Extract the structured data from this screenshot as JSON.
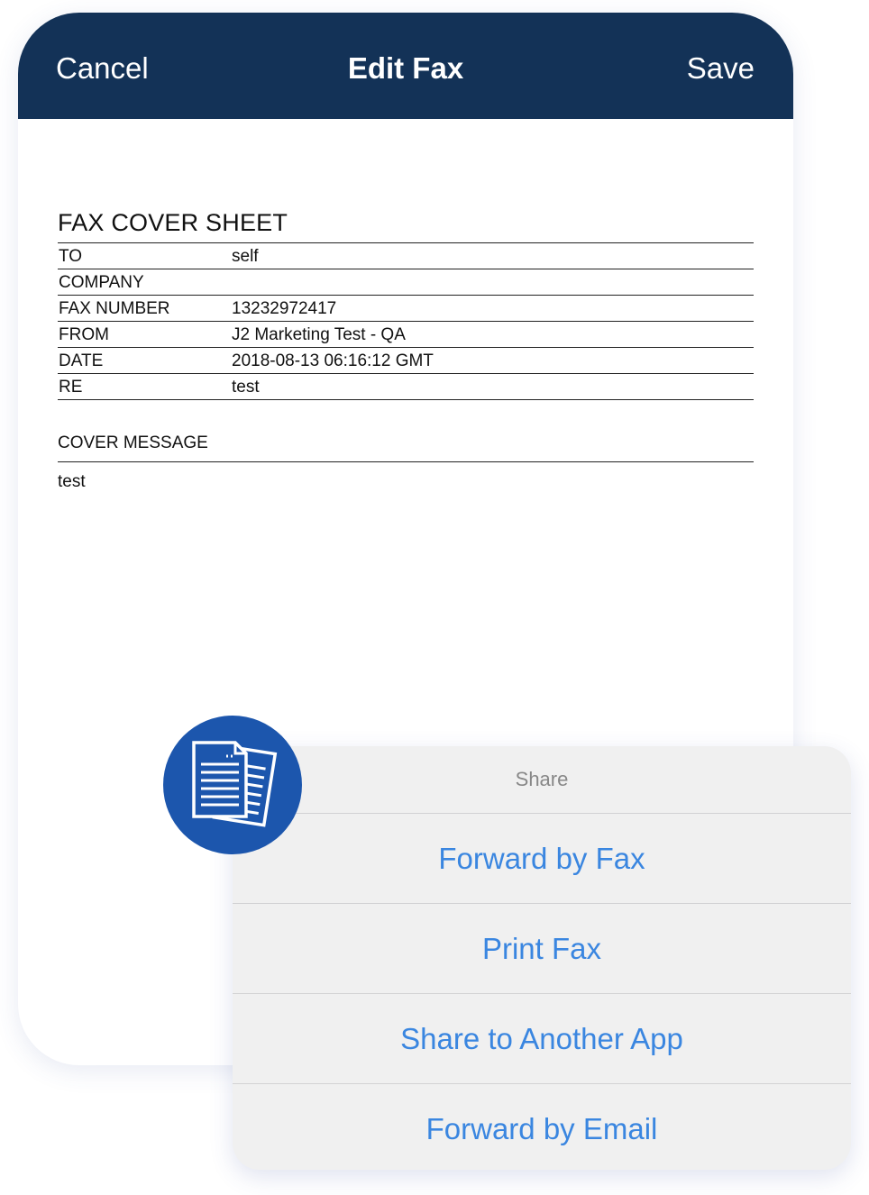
{
  "navbar": {
    "cancel_label": "Cancel",
    "title": "Edit Fax",
    "save_label": "Save",
    "background_color": "#133257"
  },
  "document": {
    "title": "FAX COVER SHEET",
    "rows": [
      {
        "label": "TO",
        "value": "self"
      },
      {
        "label": "COMPANY",
        "value": ""
      },
      {
        "label": "FAX NUMBER",
        "value": "13232972417"
      },
      {
        "label": "FROM",
        "value": "J2 Marketing Test - QA"
      },
      {
        "label": "DATE",
        "value": "2018-08-13 06:16:12 GMT"
      },
      {
        "label": "RE",
        "value": "test"
      }
    ],
    "cover_message_label": "COVER MESSAGE",
    "cover_message": "test"
  },
  "share_sheet": {
    "title": "Share",
    "items": [
      {
        "label": "Forward by Fax"
      },
      {
        "label": "Print Fax"
      },
      {
        "label": "Share to Another App"
      },
      {
        "label": "Forward by Email"
      }
    ],
    "accent_color": "#3a86e0"
  },
  "badge": {
    "icon": "documents-icon",
    "color": "#1c56ad"
  }
}
